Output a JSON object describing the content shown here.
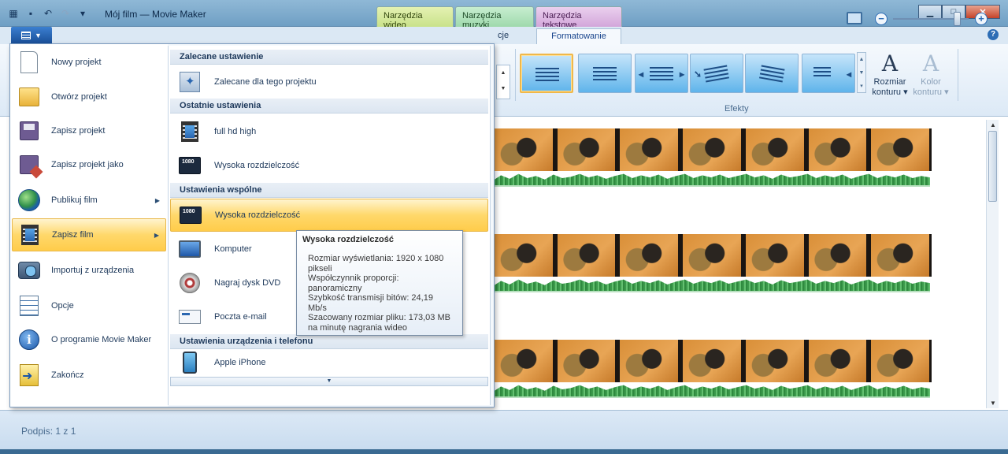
{
  "window": {
    "title": "Mój film — Movie Maker",
    "context_tabs": [
      "Narzędzia wideo",
      "Narzędzia muzyki",
      "Narzędzia tekstowe"
    ],
    "controls": [
      "minimize",
      "maximize",
      "close"
    ]
  },
  "ribbon": {
    "partial_tab": "cje",
    "active_tab": "Formatowanie",
    "group_label": "Efekty",
    "size_button": {
      "line1": "Rozmiar",
      "line2": "konturu"
    },
    "color_button": {
      "line1": "Kolor",
      "line2": "konturu"
    },
    "effect_count": 6
  },
  "app_menu": {
    "items": [
      {
        "label": "Nowy projekt",
        "icon": "new-document-icon"
      },
      {
        "label": "Otwórz projekt",
        "icon": "open-folder-icon"
      },
      {
        "label": "Zapisz projekt",
        "icon": "save-icon"
      },
      {
        "label": "Zapisz projekt jako",
        "icon": "save-as-icon"
      },
      {
        "label": "Publikuj film",
        "icon": "globe-icon",
        "submenu": true
      },
      {
        "label": "Zapisz film",
        "icon": "film-icon",
        "submenu": true,
        "highlighted": true
      },
      {
        "label": "Importuj z urządzenia",
        "icon": "camera-icon"
      },
      {
        "label": "Opcje",
        "icon": "options-icon"
      },
      {
        "label": "O programie Movie Maker",
        "icon": "info-icon"
      },
      {
        "label": "Zakończ",
        "icon": "exit-icon"
      }
    ]
  },
  "save_submenu": {
    "sections": [
      {
        "header": "Zalecane ustawienie",
        "items": [
          {
            "label": "Zalecane dla tego projektu",
            "icon": "wizard-icon"
          }
        ]
      },
      {
        "header": "Ostatnie ustawienia",
        "items": [
          {
            "label": "full hd high",
            "icon": "film-icon"
          },
          {
            "label": "Wysoka rozdzielczość",
            "icon": "hd-1080-icon"
          }
        ]
      },
      {
        "header": "Ustawienia wspólne",
        "items": [
          {
            "label": "Wysoka rozdzielczość",
            "icon": "hd-1080-icon",
            "highlighted": true
          },
          {
            "label": "Komputer",
            "icon": "computer-icon"
          },
          {
            "label": "Nagraj dysk DVD",
            "icon": "dvd-icon"
          },
          {
            "label": "Poczta e-mail",
            "icon": "email-icon"
          }
        ]
      },
      {
        "header": "Ustawienia urządzenia i telefonu",
        "items": [
          {
            "label": "Apple iPhone",
            "icon": "phone-icon"
          }
        ]
      }
    ],
    "hd_badge": "1080"
  },
  "tooltip": {
    "title": "Wysoka rozdzielczość",
    "lines": [
      "Rozmiar wyświetlania: 1920 x 1080",
      "pikseli",
      "Współczynnik proporcji:",
      "panoramiczny",
      "Szybkość transmisji bitów: 24,19",
      "Mb/s",
      "Szacowany rozmiar pliku: 173,03 MB",
      "na minutę nagrania wideo"
    ]
  },
  "status": {
    "text": "Podpis: 1 z 1"
  },
  "colors": {
    "highlight": "#ffd86b",
    "accent": "#1a56a8"
  }
}
